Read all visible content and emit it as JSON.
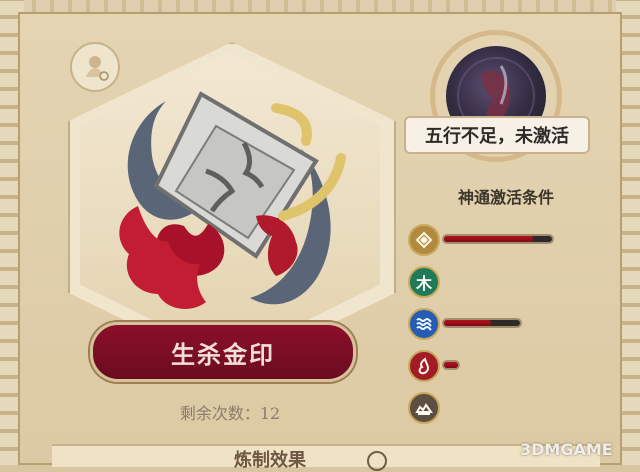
{
  "item": {
    "name": "生杀金印",
    "remaining_label": "剩余次数：12"
  },
  "status": {
    "orb_label": "五行不足，未激活",
    "conditions_title": "神通激活条件"
  },
  "bottom": {
    "title": "炼制效果"
  },
  "elements": [
    {
      "icon": "metal-icon",
      "label": "",
      "progress": 0.82,
      "color": "#b18a3f"
    },
    {
      "icon": "wood-icon",
      "label": "木",
      "progress": 0,
      "color": "#1f7a57"
    },
    {
      "icon": "water-icon",
      "label": "",
      "progress": 0.62,
      "color": "#265db3"
    },
    {
      "icon": "fire-icon",
      "label": "",
      "progress": 0.08,
      "color": "#a11c24"
    },
    {
      "icon": "earth-icon",
      "label": "",
      "progress": 0,
      "color": "#5d4e42"
    }
  ],
  "watermark": "3DMGAME"
}
